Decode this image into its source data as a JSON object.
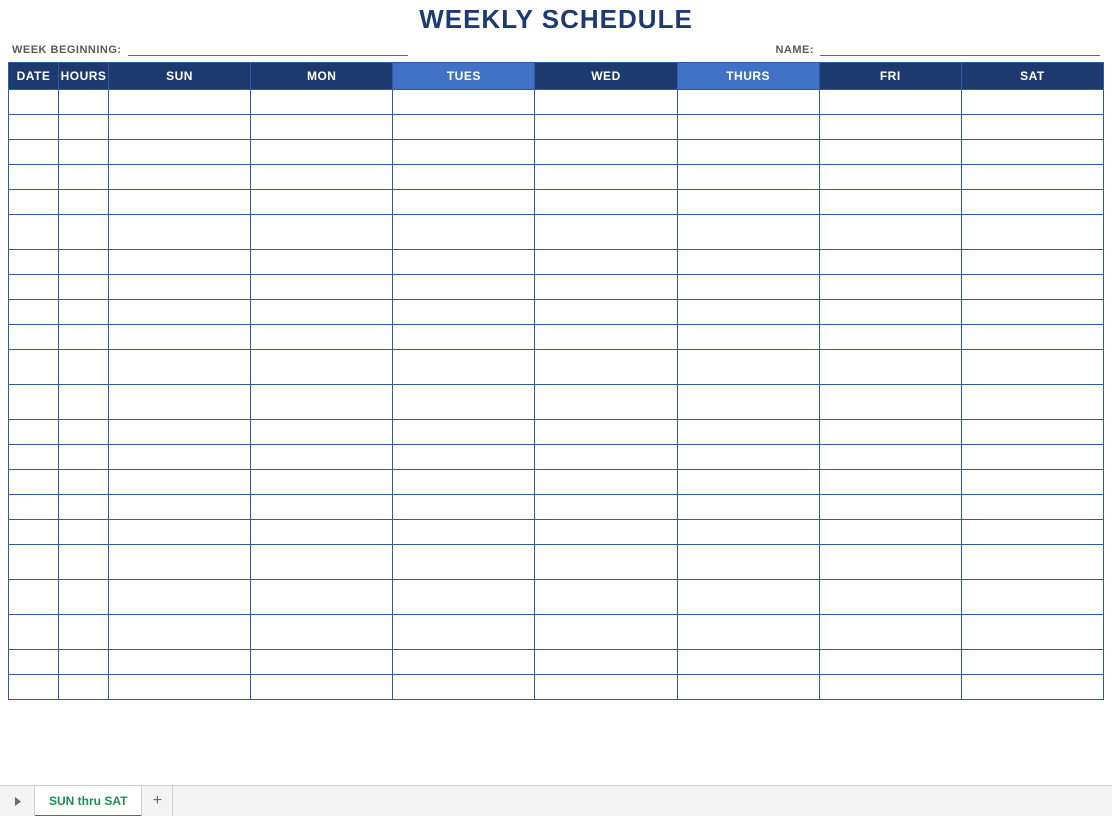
{
  "title": "WEEKLY SCHEDULE",
  "meta": {
    "week_beginning_label": "WEEK BEGINNING:",
    "week_beginning_value": "",
    "name_label": "NAME:",
    "name_value": ""
  },
  "columns": [
    {
      "key": "date",
      "label": "DATE",
      "shade": "dark"
    },
    {
      "key": "hours",
      "label": "HOURS",
      "shade": "dark"
    },
    {
      "key": "sun",
      "label": "SUN",
      "shade": "dark"
    },
    {
      "key": "mon",
      "label": "MON",
      "shade": "dark"
    },
    {
      "key": "tues",
      "label": "TUES",
      "shade": "light"
    },
    {
      "key": "wed",
      "label": "WED",
      "shade": "dark"
    },
    {
      "key": "thurs",
      "label": "THURS",
      "shade": "light"
    },
    {
      "key": "fri",
      "label": "FRI",
      "shade": "dark"
    },
    {
      "key": "sat",
      "label": "SAT",
      "shade": "dark"
    }
  ],
  "row_count": 22,
  "big_rows": [
    5,
    10,
    11,
    17,
    18,
    19
  ],
  "tabs": {
    "active": "SUN thru SAT"
  }
}
